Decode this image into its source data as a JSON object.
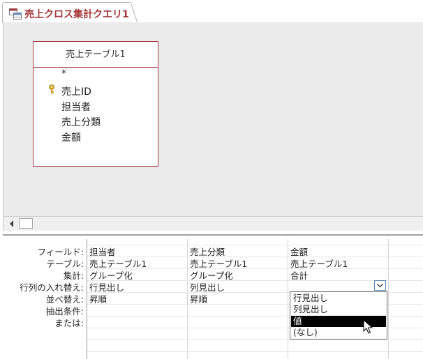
{
  "tab": {
    "title": "売上クロス集計クエリ1",
    "icon": "crosstab-query-icon"
  },
  "table": {
    "title": "売上テーブル1",
    "fields": [
      "*",
      "売上ID",
      "担当者",
      "売上分類",
      "金額"
    ],
    "key_field": "売上ID"
  },
  "grid": {
    "row_labels": [
      "フィールド:",
      "テーブル:",
      "集計:",
      "行列の入れ替え:",
      "並べ替え:",
      "抽出条件:",
      "または:"
    ],
    "columns": [
      {
        "field": "担当者",
        "table": "売上テーブル1",
        "total": "グループ化",
        "crosstab": "行見出し",
        "sort": "昇順"
      },
      {
        "field": "売上分類",
        "table": "売上テーブル1",
        "total": "グループ化",
        "crosstab": "列見出し",
        "sort": "昇順"
      },
      {
        "field": "金額",
        "table": "売上テーブル1",
        "total": "合計",
        "crosstab": "",
        "sort": ""
      }
    ]
  },
  "dropdown": {
    "options": [
      "行見出し",
      "列見出し",
      "値",
      "(なし)"
    ],
    "selected": "値"
  },
  "colors": {
    "accent": "#a4373a",
    "selection": "#000000",
    "canvas": "#ebebeb"
  }
}
